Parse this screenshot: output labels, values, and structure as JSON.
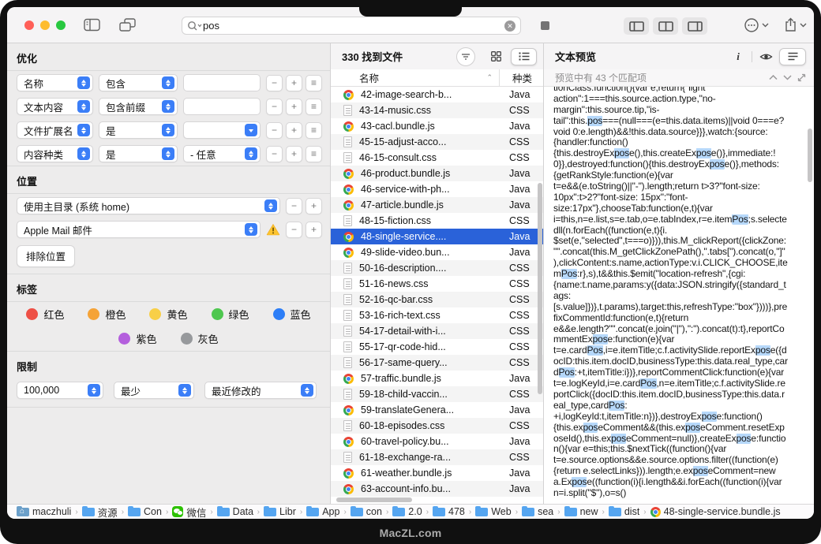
{
  "toolbar": {
    "search_value": "pos",
    "traffic_lights": [
      "close",
      "minimize",
      "zoom"
    ],
    "pane_buttons": [
      "left-pane",
      "middle-pane",
      "right-pane"
    ]
  },
  "left_panel": {
    "refine": {
      "title": "优化",
      "rows": [
        {
          "attr": "名称",
          "op": "包含",
          "value": "",
          "value_type": "text"
        },
        {
          "attr": "文本内容",
          "op": "包含前缀",
          "value": "",
          "value_type": "text"
        },
        {
          "attr": "文件扩展名",
          "op": "是",
          "value": "",
          "value_type": "combo"
        },
        {
          "attr": "内容种类",
          "op": "是",
          "value": "- 任意",
          "value_type": "select"
        }
      ]
    },
    "location": {
      "title": "位置",
      "rows": [
        {
          "value": "使用主目录 (系统 home)",
          "warning": false
        },
        {
          "value": "Apple Mail 邮件",
          "warning": true
        }
      ],
      "exclude_button": "排除位置"
    },
    "tags": {
      "title": "标签",
      "row1": [
        {
          "label": "红色",
          "color": "#ee5046"
        },
        {
          "label": "橙色",
          "color": "#f5a337"
        },
        {
          "label": "黄色",
          "color": "#f8cf47"
        },
        {
          "label": "绿色",
          "color": "#4ec74f"
        },
        {
          "label": "蓝色",
          "color": "#2d7ef7"
        }
      ],
      "row2": [
        {
          "label": "紫色",
          "color": "#b45fdd"
        },
        {
          "label": "灰色",
          "color": "#97999c"
        }
      ]
    },
    "limit": {
      "title": "限制",
      "count": "100,000",
      "mode": "最少",
      "sort": "最近修改的"
    }
  },
  "file_list": {
    "header": "330 找到文件",
    "columns": [
      "名称",
      "种类"
    ],
    "rows": [
      {
        "name": "42-image-search-b...",
        "kind": "Java",
        "icon": "chrome",
        "selected": false
      },
      {
        "name": "43-14-music.css",
        "kind": "CSS",
        "icon": "doc",
        "selected": false
      },
      {
        "name": "43-cacl.bundle.js",
        "kind": "Java",
        "icon": "chrome",
        "selected": false
      },
      {
        "name": "45-15-adjust-acco...",
        "kind": "CSS",
        "icon": "doc",
        "selected": false
      },
      {
        "name": "46-15-consult.css",
        "kind": "CSS",
        "icon": "doc",
        "selected": false
      },
      {
        "name": "46-product.bundle.js",
        "kind": "Java",
        "icon": "chrome",
        "selected": false
      },
      {
        "name": "46-service-with-ph...",
        "kind": "Java",
        "icon": "chrome",
        "selected": false
      },
      {
        "name": "47-article.bundle.js",
        "kind": "Java",
        "icon": "chrome",
        "selected": false
      },
      {
        "name": "48-15-fiction.css",
        "kind": "CSS",
        "icon": "doc",
        "selected": false
      },
      {
        "name": "48-single-service....",
        "kind": "Java",
        "icon": "chrome",
        "selected": true
      },
      {
        "name": "49-slide-video.bun...",
        "kind": "Java",
        "icon": "chrome",
        "selected": false
      },
      {
        "name": "50-16-description....",
        "kind": "CSS",
        "icon": "doc",
        "selected": false
      },
      {
        "name": "51-16-news.css",
        "kind": "CSS",
        "icon": "doc",
        "selected": false
      },
      {
        "name": "52-16-qc-bar.css",
        "kind": "CSS",
        "icon": "doc",
        "selected": false
      },
      {
        "name": "53-16-rich-text.css",
        "kind": "CSS",
        "icon": "doc",
        "selected": false
      },
      {
        "name": "54-17-detail-with-i...",
        "kind": "CSS",
        "icon": "doc",
        "selected": false
      },
      {
        "name": "55-17-qr-code-hid...",
        "kind": "CSS",
        "icon": "doc",
        "selected": false
      },
      {
        "name": "56-17-same-query...",
        "kind": "CSS",
        "icon": "doc",
        "selected": false
      },
      {
        "name": "57-traffic.bundle.js",
        "kind": "Java",
        "icon": "chrome",
        "selected": false
      },
      {
        "name": "59-18-child-vaccin...",
        "kind": "CSS",
        "icon": "doc",
        "selected": false
      },
      {
        "name": "59-translateGenera...",
        "kind": "Java",
        "icon": "chrome",
        "selected": false
      },
      {
        "name": "60-18-episodes.css",
        "kind": "CSS",
        "icon": "doc",
        "selected": false
      },
      {
        "name": "60-travel-policy.bu...",
        "kind": "Java",
        "icon": "chrome",
        "selected": false
      },
      {
        "name": "61-18-exchange-ra...",
        "kind": "CSS",
        "icon": "doc",
        "selected": false
      },
      {
        "name": "61-weather.bundle.js",
        "kind": "Java",
        "icon": "chrome",
        "selected": false
      },
      {
        "name": "63-account-info.bu...",
        "kind": "Java",
        "icon": "chrome",
        "selected": false
      }
    ]
  },
  "preview": {
    "title": "文本预览",
    "match_info": "预览中有 43 个匹配项",
    "highlight_term": "pos",
    "highlight_color": "#b6d8fa",
    "lines": [
      "tionClass:function(){var e;return{\"light",
      "action\":1===this.source.action.type,\"no-",
      "margin\":this.source.tip,\"is-",
      "tail\":this.pos===(null===(e=this.data.items)||void 0===e?",
      "void 0:e.length)&&!this.data.source}}},watch:{source:",
      "{handler:function()",
      "{this.destroyExpose(),this.createExpose()},immediate:!",
      "0}},destroyed:function(){this.destroyExpose()},methods:",
      "{getRankStyle:function(e){var",
      "t=e&&(e.toString()||\"-\").length;return t>3?\"font-size:",
      "10px\":t>2?\"font-size: 15px\":\"font-",
      "size:17px\"},chooseTab:function(e,t){var",
      "i=this,n=e.list,s=e.tab,o=e.tabIndex,r=e.itemPos;s.selecte",
      "dll(n.forEach((function(e,t){i.",
      "$set(e,\"selected\",t===o)})),this.M_clickReport({clickZone:",
      "\"\".concat(this.M_getClickZonePath(),\".tabs[\").concat(o,\"]\"",
      "),clickContent:s.name,actionType:v.i.CLICK_CHOOSE,ite",
      "mPos:r},s),t&&this.$emit(\"location-refresh\",{cgi:",
      "{name:t.name,params:y({data:JSON.stringify({standard_t",
      "ags:",
      "[s.value]})},t.params),target:this,refreshType:\"box\"})))},pre",
      "fixCommentId:function(e,t){return",
      "e&&e.length?\"\".concat(e.join(\"|\"),\":\").concat(t):t},reportCo",
      "mmentExpose:function(e){var",
      "t=e.cardPos,i=e.itemTitle;c.f.activitySlide.reportExpose({d",
      "ocID:this.item.docID,businessType:this.data.real_type,car",
      "dPos:+t,itemTitle:i})},reportCommentClick:function(e){var",
      "t=e.logKeyId,i=e.cardPos,n=e.itemTitle;c.f.activitySlide.re",
      "portClick({docID:this.item.docID,businessType:this.data.r",
      "eal_type,cardPos:",
      "+i,logKeyId:t,itemTitle:n})},destroyExpose:function()",
      "{this.exposeComment&&(this.exposeComment.resetExp",
      "oseId(),this.exposeComment=null)},createExpose:functio",
      "n(){var e=this;this.$nextTick((function(){var",
      "t=e.source.options&&e.source.options.filter((function(e)",
      "{return e.selectLinks})).length;e.exposeComment=new",
      "a.Expose((function(i){i.length&&i.forEach((function(i){var",
      "n=i.split(\"$\"),o=s()"
    ]
  },
  "breadcrumbs": [
    {
      "label": "maczhuli",
      "icon": "home"
    },
    {
      "label": "资源",
      "icon": "folder"
    },
    {
      "label": "Con",
      "icon": "folder"
    },
    {
      "label": "微信",
      "icon": "wechat"
    },
    {
      "label": "Data",
      "icon": "folder"
    },
    {
      "label": "Libr",
      "icon": "folder"
    },
    {
      "label": "App",
      "icon": "folder"
    },
    {
      "label": "con",
      "icon": "folder"
    },
    {
      "label": "2.0",
      "icon": "folder"
    },
    {
      "label": "478",
      "icon": "folder"
    },
    {
      "label": "Web",
      "icon": "folder"
    },
    {
      "label": "sea",
      "icon": "folder"
    },
    {
      "label": "new",
      "icon": "folder"
    },
    {
      "label": "dist",
      "icon": "folder"
    },
    {
      "label": "48-single-service.bundle.js",
      "icon": "chrome"
    }
  ],
  "watermark": "MacZL.com"
}
